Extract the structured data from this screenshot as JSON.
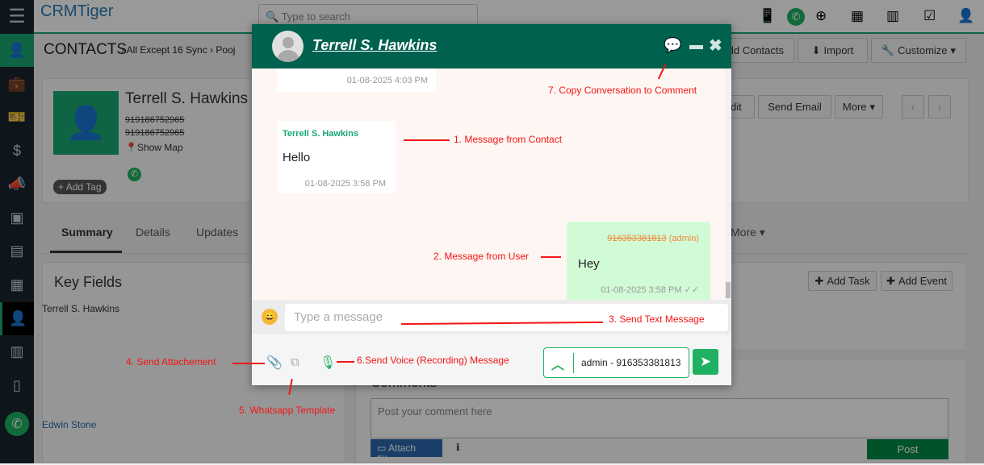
{
  "app": {
    "logo": "CRMTiger",
    "search_placeholder": "Type to search"
  },
  "sidebar": {
    "items": [
      "menu",
      "contacts",
      "briefcase",
      "tickets",
      "money",
      "campaigns",
      "products",
      "contact-card",
      "id-card",
      "contacts-active",
      "organizations",
      "mobile-sms",
      "whatsapp"
    ]
  },
  "breadcrumb": {
    "module": "CONTACTS",
    "filter": "All Except 16 Sync",
    "record": "Pooj"
  },
  "toolbar": {
    "add_contacts": "Add Contacts",
    "import": "Import",
    "customize": "Customize"
  },
  "contact": {
    "name": "Terrell S. Hawkins",
    "phone1": "919186752965",
    "phone2": "919186752965",
    "show_map": "Show Map",
    "add_tag": "Add Tag",
    "edit": "Edit",
    "send_email": "Send Email",
    "more": "More"
  },
  "tabs": [
    "Summary",
    "Details",
    "Updates",
    "More"
  ],
  "key_fields": {
    "title": "Key Fields",
    "name": "Terrell S. Hawkins",
    "owner": "Edwin Stone"
  },
  "activities": {
    "add_task": "Add Task",
    "add_event": "Add Event"
  },
  "comments": {
    "title": "Comments",
    "placeholder": "Post your comment here",
    "attach": "Attach Files",
    "post": "Post"
  },
  "chat": {
    "contact_name": "Terrell S. Hawkins",
    "messages": [
      {
        "from": "contact",
        "sender": "",
        "text": "",
        "time": "01-08-2025 4:03 PM"
      },
      {
        "from": "contact",
        "sender": "Terrell S. Hawkins",
        "text": "Hello",
        "time": "01-08-2025 3:58 PM"
      },
      {
        "from": "user",
        "sender": "916353381813",
        "sender_suffix": "(admin)",
        "text": "Hey",
        "time": "01-08-2025 3:58 PM"
      }
    ],
    "input_placeholder": "Type a message",
    "sender_select": "admin - 916353381813",
    "colors": {
      "header": "#00614f",
      "user_bubble": "#d1fbd6",
      "accent": "#1fb161"
    }
  },
  "annotations": [
    "1. Message from Contact",
    "2. Message from User",
    "3. Send Text Message",
    "4. Send Attachement",
    "5. Whatsapp Template",
    "6.Send Voice (Recording) Message",
    "7. Copy Conversation to Comment"
  ]
}
